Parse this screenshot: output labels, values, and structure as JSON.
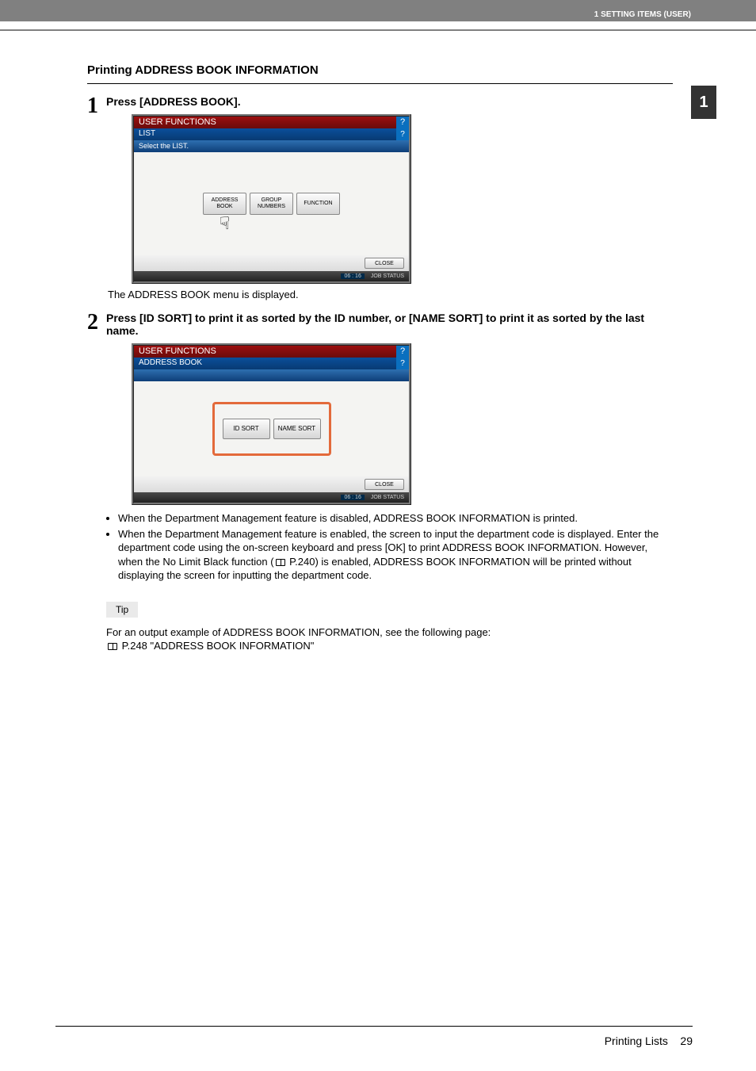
{
  "header": {
    "running": "1 SETTING ITEMS (USER)"
  },
  "sidetab": "1",
  "section_title": "Printing ADDRESS BOOK INFORMATION",
  "step1": {
    "num": "1",
    "head": "Press [ADDRESS BOOK].",
    "caption": "The ADDRESS BOOK menu is displayed.",
    "ss": {
      "title": "USER FUNCTIONS",
      "sub": "LIST",
      "hint": "Select the LIST.",
      "btn1": "ADDRESS\nBOOK",
      "btn2": "GROUP\nNUMBERS",
      "btn3": "FUNCTION",
      "close": "CLOSE",
      "status": "JOB STATUS",
      "time": "06 : 16"
    }
  },
  "step2": {
    "num": "2",
    "head": "Press [ID SORT] to print it as sorted by the ID number, or [NAME SORT] to print it as sorted by the last name.",
    "ss": {
      "title": "USER FUNCTIONS",
      "sub": "ADDRESS BOOK",
      "btn1": "ID SORT",
      "btn2": "NAME SORT",
      "close": "CLOSE",
      "status": "JOB STATUS",
      "time": "06 : 16"
    },
    "bullets": {
      "b1": "When the Department Management feature is disabled, ADDRESS BOOK INFORMATION is printed.",
      "b2a": "When the Department Management feature is enabled, the screen to input the department code is displayed. Enter the department code using the on-screen keyboard and press [OK] to print ADDRESS BOOK INFORMATION. However, when the No Limit Black function (",
      "b2ref": " P.240",
      "b2b": ") is enabled, ADDRESS BOOK INFORMATION will be printed without displaying the screen for inputting the department code."
    },
    "tip_label": "Tip",
    "tip1": "For an output example of ADDRESS BOOK INFORMATION, see the following page:",
    "tip_ref": " P.248 \"ADDRESS BOOK INFORMATION\""
  },
  "footer": {
    "section": "Printing Lists",
    "page": "29"
  }
}
